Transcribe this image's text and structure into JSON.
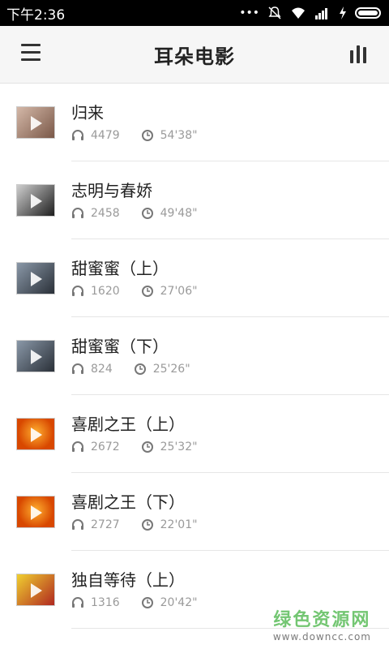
{
  "status": {
    "time": "下午2:36"
  },
  "appbar": {
    "title": "耳朵电影"
  },
  "items": [
    {
      "title": "归来",
      "listens": "4479",
      "duration": "54'38\"",
      "thumb_color": "#b09080"
    },
    {
      "title": "志明与春娇",
      "listens": "2458",
      "duration": "49'48\"",
      "thumb_color": "#3a3a3a"
    },
    {
      "title": "甜蜜蜜（上）",
      "listens": "1620",
      "duration": "27'06\"",
      "thumb_color": "#4a5560"
    },
    {
      "title": "甜蜜蜜（下）",
      "listens": "824",
      "duration": "25'26\"",
      "thumb_color": "#4a5560"
    },
    {
      "title": "喜剧之王（上）",
      "listens": "2672",
      "duration": "25'32\"",
      "thumb_color": "#e86a10"
    },
    {
      "title": "喜剧之王（下）",
      "listens": "2727",
      "duration": "22'01\"",
      "thumb_color": "#e86a10"
    },
    {
      "title": "独自等待（上）",
      "listens": "1316",
      "duration": "20'42\"",
      "thumb_color": "#d8b020"
    }
  ],
  "icons": {
    "listens": "headphones-icon",
    "duration": "clock-icon"
  },
  "watermark": {
    "line1": "绿色资源网",
    "line2": "www.downcc.com"
  }
}
